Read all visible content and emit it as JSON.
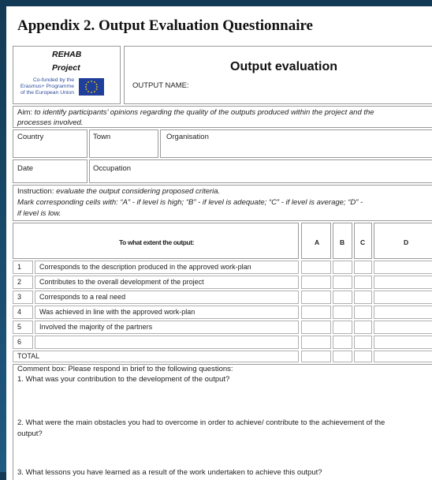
{
  "title": "Appendix 2. Output Evaluation Questionnaire",
  "header": {
    "project_line1": "REHAB",
    "project_line2": "Project",
    "eu_line1": "Co-funded by the",
    "eu_line2": "Erasmus+ Programme",
    "eu_line3": "of the European Union",
    "heading": "Output evaluation",
    "output_name_label": "OUTPUT  NAME:"
  },
  "aim": {
    "label": "Aim:",
    "text": "to identify participants’ opinions regarding the quality of the outputs produced within the project and the",
    "text2": "processes involved."
  },
  "fields": {
    "country": "Country",
    "town": "Town",
    "organisation": "Organisation",
    "date": "Date",
    "occupation": "Occupation"
  },
  "instruction": {
    "label": "Instruction:",
    "text": "evaluate the output considering proposed criteria.",
    "line2": "Mark corresponding cells with: “A” - if level is high;    “B” - if level is adequate;    “C” - if level is average;    “D” -",
    "line3": "if level is low."
  },
  "table": {
    "question": "To what extent the output:",
    "columns": [
      "A",
      "B",
      "C",
      "D"
    ],
    "rows": [
      {
        "num": "1",
        "text": "Corresponds to the description produced in the approved work-plan"
      },
      {
        "num": "2",
        "text": "Contributes to the overall development of the project"
      },
      {
        "num": "3",
        "text": "Corresponds to a real need"
      },
      {
        "num": "4",
        "text": "Was achieved in line with the approved work-plan"
      },
      {
        "num": "5",
        "text": "Involved the majority of the partners"
      },
      {
        "num": "6",
        "text": ""
      }
    ],
    "total": "TOTAL"
  },
  "comment": {
    "intro": "Comment box: Please respond in brief to the following questions:",
    "q1": "1. What was your contribution to the development of the output?",
    "q2a": "2. What were the main obstacles you had to overcome in order to achieve/ contribute to the achievement of the",
    "q2b": "output?",
    "q3": "3. What lessons you have learned as a result of the work undertaken to achieve this output?"
  }
}
